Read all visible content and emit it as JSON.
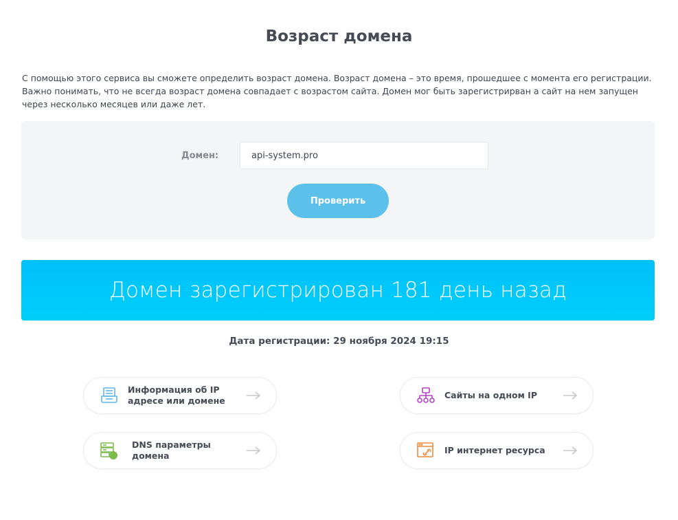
{
  "page": {
    "title": "Возраст домена",
    "intro": "С помощью этого сервиса вы сможете определить возраст домена. Возраст домена – это время, прошедшее с момента его регистрации. Важно понимать, что не всегда возраст домена совпадает с возрастом сайта. Домен мог быть зарегистрирван а сайт на нем запущен через несколько месяцев или даже лет."
  },
  "form": {
    "domain_label": "Домен:",
    "domain_value": "api-system.pro",
    "check_button": "Проверить"
  },
  "result": {
    "banner": "Домен зарегистрирован 181 день назад",
    "registration_date": "Дата регистрации: 29 ноября 2024 19:15"
  },
  "links": [
    {
      "label": "Информация об IP адресе или домене",
      "icon": "ip-info-icon",
      "color": "#5bb8e8"
    },
    {
      "label": "Сайты на одном IP",
      "icon": "network-tree-icon",
      "color": "#b53fc4"
    },
    {
      "label": "DNS параметры домена",
      "icon": "dns-server-icon",
      "color": "#7dbb4c"
    },
    {
      "label": "IP интернет ресурса",
      "icon": "browser-link-icon",
      "color": "#ef8a3f"
    }
  ],
  "colors": {
    "accent": "#5bc0ea",
    "banner": "#00c5fa",
    "panel": "#f3f5f6"
  }
}
